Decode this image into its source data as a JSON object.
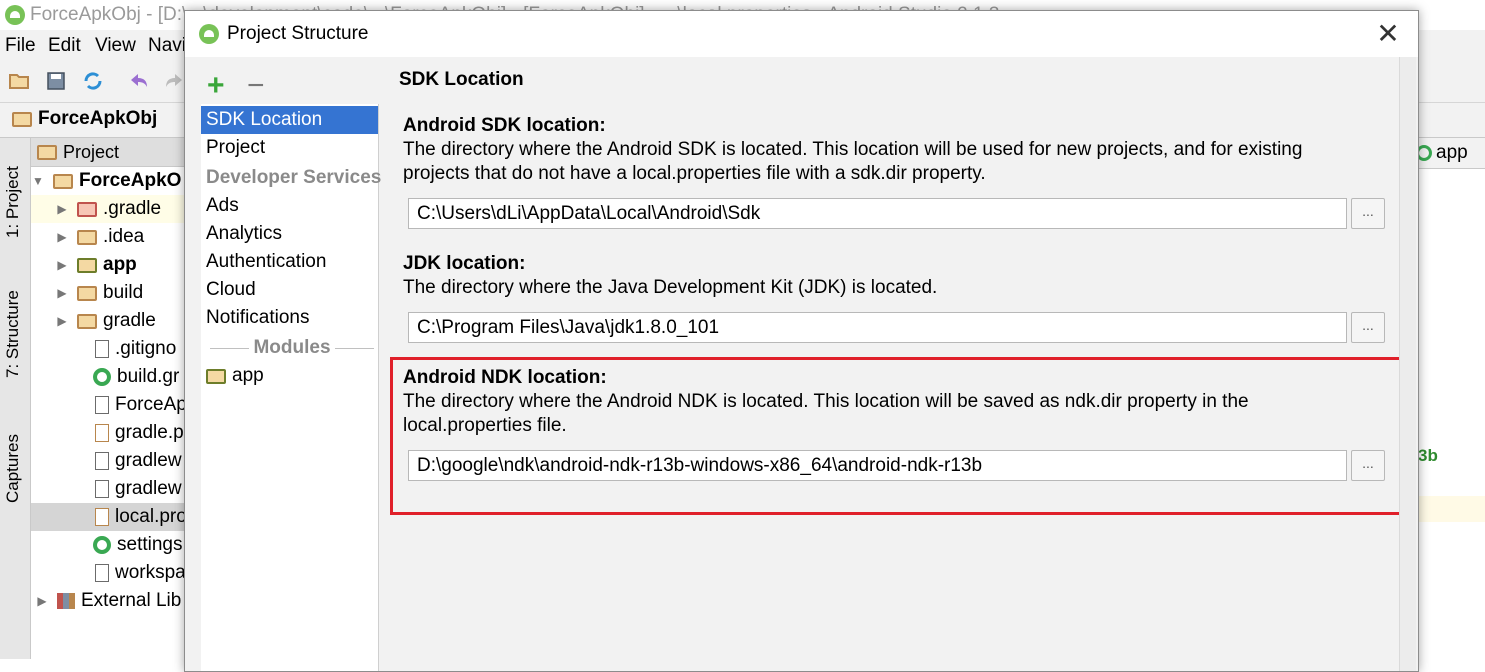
{
  "ide": {
    "title": "ForceApkObj - [D:\\...\\development\\code\\...\\ForceApkObj] - [ForceApkObj] - ...\\local.properties - Android Studio 2.1.3",
    "menu": [
      "File",
      "Edit",
      "View",
      "Navi"
    ],
    "breadcrumb": "ForceApkObj",
    "tool_tabs": [
      "1: Project",
      "7: Structure",
      "Captures"
    ],
    "project_panel_title": "Project",
    "tree": [
      {
        "label": "ForceApkO",
        "expanded": true,
        "bold": true,
        "icon": "project-folder-icon"
      },
      {
        "label": ".gradle",
        "icon": "folder-icon"
      },
      {
        "label": ".idea",
        "icon": "folder-icon"
      },
      {
        "label": "app",
        "bold": true,
        "icon": "module-folder-icon"
      },
      {
        "label": "build",
        "icon": "folder-icon"
      },
      {
        "label": "gradle",
        "icon": "folder-icon"
      },
      {
        "label": ".gitigno",
        "icon": "file-icon"
      },
      {
        "label": "build.gr",
        "icon": "gradle-icon"
      },
      {
        "label": "ForceAp",
        "icon": "file-icon"
      },
      {
        "label": "gradle.p",
        "icon": "properties-icon"
      },
      {
        "label": "gradlew",
        "icon": "file-icon"
      },
      {
        "label": "gradlew",
        "icon": "file-icon"
      },
      {
        "label": "local.pro",
        "icon": "properties-icon",
        "selected": true
      },
      {
        "label": "settings",
        "icon": "gradle-icon"
      },
      {
        "label": "workspa",
        "icon": "file-icon"
      },
      {
        "label": "External Lib",
        "icon": "library-icon"
      }
    ],
    "right_tab": "app",
    "right_fragment": "3b"
  },
  "dialog": {
    "title": "Project Structure",
    "add_label": "+",
    "remove_label": "−",
    "close_label": "✕",
    "list": {
      "sdk_location": "SDK Location",
      "project": "Project",
      "developer_services": "Developer Services",
      "ads": "Ads",
      "analytics": "Analytics",
      "authentication": "Authentication",
      "cloud": "Cloud",
      "notifications": "Notifications",
      "modules": "Modules",
      "app": "app"
    },
    "pane_title": "SDK Location",
    "sdk": {
      "label": "Android SDK location:",
      "desc": "The directory where the Android SDK is located. This location will be used for new projects, and for existing projects that do not have a local.properties file with a sdk.dir property.",
      "value": "C:\\Users\\dLi\\AppData\\Local\\Android\\Sdk"
    },
    "jdk": {
      "label": "JDK location:",
      "desc": "The directory where the Java Development Kit (JDK) is located.",
      "value": "C:\\Program Files\\Java\\jdk1.8.0_101"
    },
    "ndk": {
      "label": "Android NDK location:",
      "desc": "The directory where the Android NDK is located. This location will be saved as ndk.dir property in the local.properties file.",
      "value": "D:\\google\\ndk\\android-ndk-r13b-windows-x86_64\\android-ndk-r13b"
    },
    "browse_label": "...",
    "colors": {
      "selection": "#3574d2",
      "highlight": "#e0202a",
      "add_green": "#3aa63a"
    }
  }
}
